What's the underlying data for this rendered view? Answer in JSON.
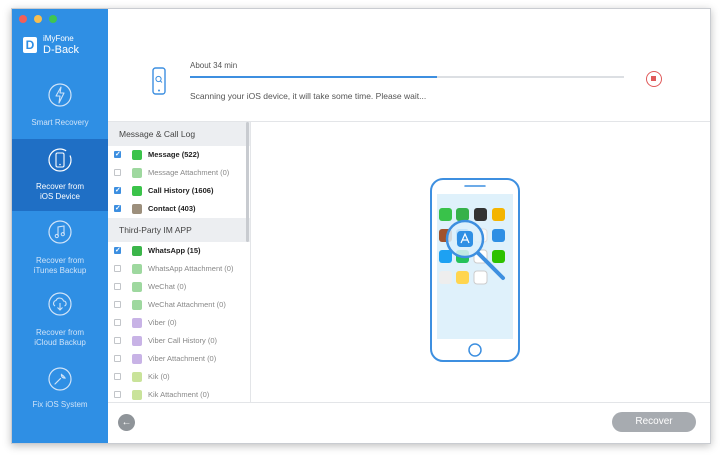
{
  "app": {
    "name": "iMyFone",
    "product": "D-Back",
    "logo_letter": "D"
  },
  "sidebar": {
    "items": [
      {
        "label": "Smart Recovery",
        "icon": "lightning-icon",
        "active": false
      },
      {
        "label": "Recover from\niOS Device",
        "icon": "phone-refresh-icon",
        "active": true
      },
      {
        "label": "Recover from\niTunes Backup",
        "icon": "music-note-icon",
        "active": false
      },
      {
        "label": "Recover from\niCloud Backup",
        "icon": "cloud-download-icon",
        "active": false
      },
      {
        "label": "Fix iOS System",
        "icon": "wrench-icon",
        "active": false
      }
    ]
  },
  "progress": {
    "time_remaining": "About 34 min",
    "percent": 57,
    "message": "Scanning your iOS device, it will take some time. Please wait..."
  },
  "groups": [
    {
      "title": "Message & Call Log",
      "items": [
        {
          "label": "Message (522)",
          "checked": true,
          "found": true,
          "icon": "message-icon",
          "color": "#3bc34a"
        },
        {
          "label": "Message Attachment (0)",
          "checked": false,
          "found": false,
          "icon": "message-attachment-icon",
          "color": "#9ed89f"
        },
        {
          "label": "Call History (1606)",
          "checked": true,
          "found": true,
          "icon": "phone-icon",
          "color": "#3bc34a"
        },
        {
          "label": "Contact (403)",
          "checked": true,
          "found": true,
          "icon": "contact-icon",
          "color": "#9c8f7c"
        }
      ]
    },
    {
      "title": "Third-Party IM APP",
      "items": [
        {
          "label": "WhatsApp (15)",
          "checked": true,
          "found": true,
          "icon": "whatsapp-icon",
          "color": "#3bb54a"
        },
        {
          "label": "WhatsApp Attachment (0)",
          "checked": false,
          "found": false,
          "icon": "whatsapp-attachment-icon",
          "color": "#9ed89f"
        },
        {
          "label": "WeChat (0)",
          "checked": false,
          "found": false,
          "icon": "wechat-icon",
          "color": "#9ed89f"
        },
        {
          "label": "WeChat Attachment (0)",
          "checked": false,
          "found": false,
          "icon": "wechat-attachment-icon",
          "color": "#9ed89f"
        },
        {
          "label": "Viber (0)",
          "checked": false,
          "found": false,
          "icon": "viber-icon",
          "color": "#c8b3e6"
        },
        {
          "label": "Viber Call History (0)",
          "checked": false,
          "found": false,
          "icon": "viber-call-icon",
          "color": "#c8b3e6"
        },
        {
          "label": "Viber Attachment (0)",
          "checked": false,
          "found": false,
          "icon": "viber-attachment-icon",
          "color": "#c8b3e6"
        },
        {
          "label": "Kik (0)",
          "checked": false,
          "found": false,
          "icon": "kik-icon",
          "color": "#c9e39a"
        },
        {
          "label": "Kik Attachment (0)",
          "checked": false,
          "found": false,
          "icon": "kik-attachment-icon",
          "color": "#c9e39a"
        }
      ]
    }
  ],
  "buttons": {
    "recover": "Recover",
    "back_icon": "←"
  },
  "colors": {
    "sidebar_bg": "#2f8fe4",
    "sidebar_active": "#1f6fc5",
    "accent": "#3d8fe0",
    "stop": "#e05a5a"
  }
}
